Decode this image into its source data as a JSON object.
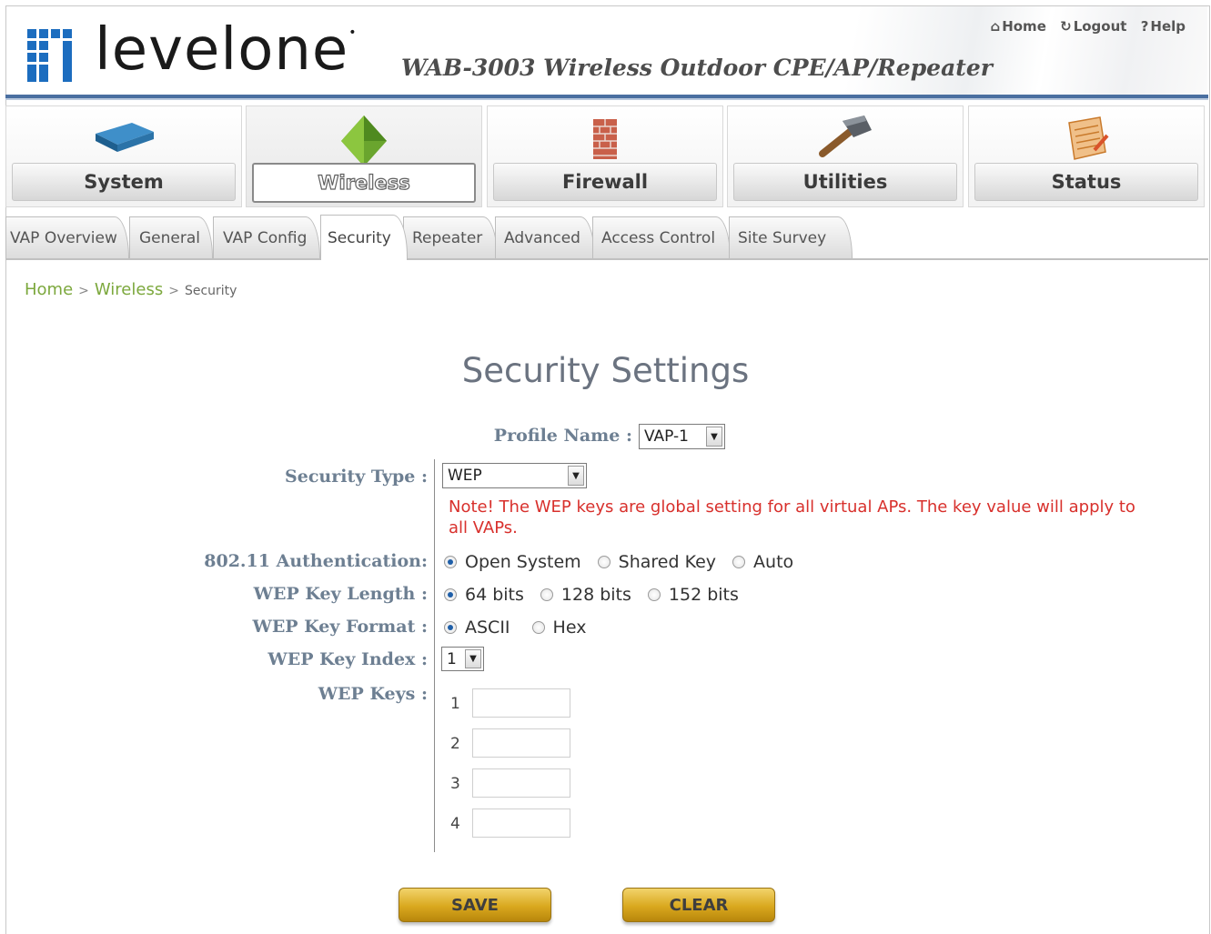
{
  "header": {
    "logo_text": "levelone",
    "product_title": "WAB-3003 Wireless Outdoor CPE/AP/Repeater",
    "links": {
      "home": "Home",
      "logout": "Logout",
      "help": "Help"
    }
  },
  "main_menu": [
    {
      "label": "System",
      "icon": "router-icon"
    },
    {
      "label": "Wireless",
      "icon": "wireless-icon",
      "active": true
    },
    {
      "label": "Firewall",
      "icon": "firewall-icon"
    },
    {
      "label": "Utilities",
      "icon": "hammer-icon"
    },
    {
      "label": "Status",
      "icon": "notepad-icon"
    }
  ],
  "tabs": [
    {
      "label": "VAP Overview"
    },
    {
      "label": "General"
    },
    {
      "label": "VAP Config"
    },
    {
      "label": "Security",
      "active": true
    },
    {
      "label": "Repeater"
    },
    {
      "label": "Advanced"
    },
    {
      "label": "Access Control"
    },
    {
      "label": "Site Survey"
    }
  ],
  "breadcrumb": {
    "home": "Home",
    "sep": ">",
    "wireless": "Wireless",
    "current": "Security"
  },
  "page_title": "Security Settings",
  "form": {
    "profile_name_label": "Profile Name :",
    "profile_name_value": "VAP-1",
    "security_type_label": "Security Type :",
    "security_type_value": "WEP",
    "note": "Note! The WEP keys are global setting for all virtual APs. The key value will apply to all VAPs.",
    "auth_label": "802.11 Authentication:",
    "auth_options": [
      "Open System",
      "Shared Key",
      "Auto"
    ],
    "auth_selected": "Open System",
    "key_length_label": "WEP Key Length :",
    "key_length_options": [
      "64 bits",
      "128 bits",
      "152 bits"
    ],
    "key_length_selected": "64 bits",
    "key_format_label": "WEP Key Format :",
    "key_format_options": [
      "ASCII",
      "Hex"
    ],
    "key_format_selected": "ASCII",
    "key_index_label": "WEP Key Index :",
    "key_index_value": "1",
    "keys_label": "WEP Keys :",
    "keys": [
      {
        "index": "1",
        "value": ""
      },
      {
        "index": "2",
        "value": ""
      },
      {
        "index": "3",
        "value": ""
      },
      {
        "index": "4",
        "value": ""
      }
    ]
  },
  "buttons": {
    "save": "SAVE",
    "clear": "CLEAR"
  },
  "colors": {
    "accent_blue": "#4a6fa0",
    "breadcrumb_green": "#7ca83d",
    "note_red": "#d8302c",
    "button_gold": "#d9a81e",
    "label_color": "#6d7f92"
  }
}
